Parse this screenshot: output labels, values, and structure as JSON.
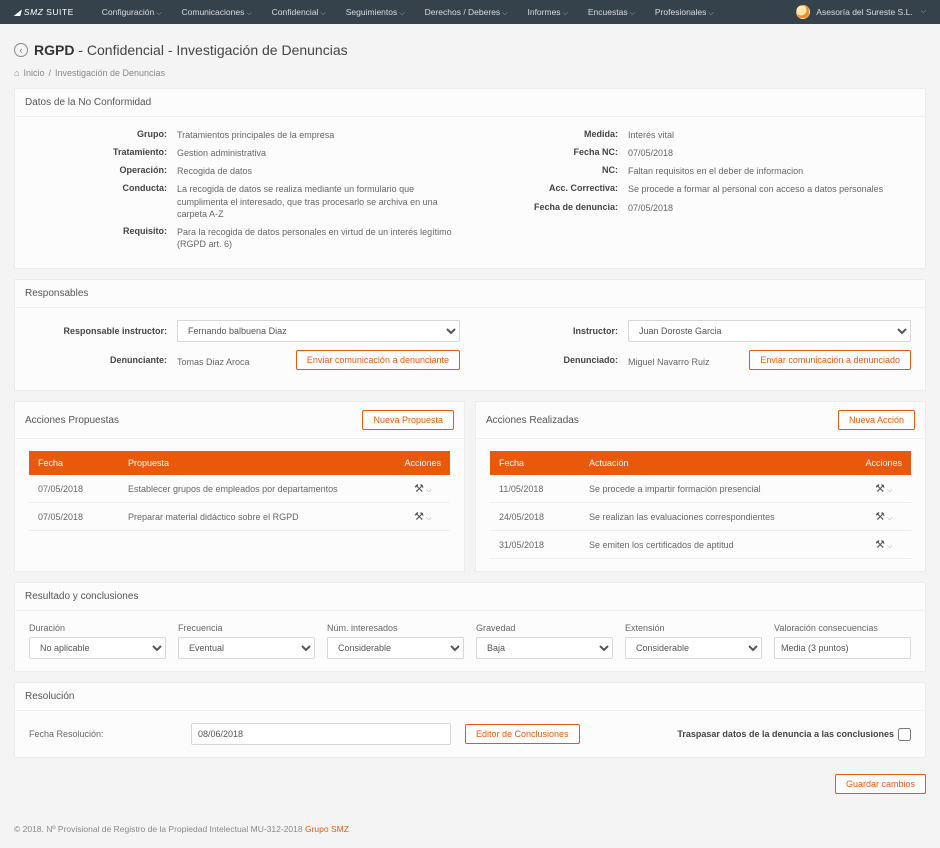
{
  "nav": {
    "brand": "SMZ SUITE",
    "items": [
      "Configuración",
      "Comunicaciones",
      "Confidencial",
      "Seguimientos",
      "Derechos / Deberes",
      "Informes",
      "Encuestas",
      "Profesionales"
    ],
    "user": "Asesoría del Sureste S.L."
  },
  "title": {
    "strong": "RGPD",
    "rest": " - Confidencial - Investigación de Denuncias"
  },
  "breadcrumb": {
    "home": "Inicio",
    "current": "Investigación de Denuncias"
  },
  "nc": {
    "header": "Datos de la No Conformidad",
    "left": [
      {
        "l": "Grupo:",
        "v": "Tratamientos principales de la empresa"
      },
      {
        "l": "Tratamiento:",
        "v": "Gestion administrativa"
      },
      {
        "l": "Operación:",
        "v": "Recogida de datos"
      },
      {
        "l": "Conducta:",
        "v": "La recogida de datos se realiza mediante un formulario que cumplimenta el interesado, que tras procesarlo se archiva en una carpeta A-Z"
      },
      {
        "l": "Requisito:",
        "v": "Para la recogida de datos personales en virtud de un interés legítimo (RGPD art. 6)"
      }
    ],
    "right": [
      {
        "l": "Medida:",
        "v": "Interés vital"
      },
      {
        "l": "Fecha NC:",
        "v": "07/05/2018"
      },
      {
        "l": "NC:",
        "v": "Faltan requisitos en el deber de informacion"
      },
      {
        "l": "Acc. Correctiva:",
        "v": "Se procede a formar al personal con acceso a datos personales"
      },
      {
        "l": "Fecha de denuncia:",
        "v": "07/05/2018"
      }
    ]
  },
  "resp": {
    "header": "Responsables",
    "instructor_label": "Responsable instructor:",
    "instructor_value": "Fernando balbuena Diaz",
    "instructor2_label": "Instructor:",
    "instructor2_value": "Juan Doroste Garcia",
    "den_label": "Denunciante:",
    "den_value": "Tomas Diaz Aroca",
    "denado_label": "Denunciado:",
    "denado_value": "Miguel Navarro Ruiz",
    "btn_denunciante": "Enviar comunicación a denunciante",
    "btn_denunciado": "Enviar comunicación a denunciado"
  },
  "propuestas": {
    "header": "Acciones Propuestas",
    "new_btn": "Nueva Propuesta",
    "cols": [
      "Fecha",
      "Propuesta",
      "Acciones"
    ],
    "rows": [
      {
        "f": "07/05/2018",
        "p": "Establecer grupos de empleados por departamentos"
      },
      {
        "f": "07/05/2018",
        "p": "Preparar material didáctico sobre el RGPD"
      }
    ]
  },
  "realizadas": {
    "header": "Acciones Realizadas",
    "new_btn": "Nueva Acción",
    "cols": [
      "Fecha",
      "Actuación",
      "Acciones"
    ],
    "rows": [
      {
        "f": "11/05/2018",
        "p": "Se procede a impartir formación presencial"
      },
      {
        "f": "24/05/2018",
        "p": "Se realizan las evaluaciones correspondientes"
      },
      {
        "f": "31/05/2018",
        "p": "Se emiten los certificados de aptitud"
      }
    ]
  },
  "result": {
    "header": "Resultado y conclusiones",
    "fields": {
      "duracion": {
        "l": "Duración",
        "v": "No aplicable"
      },
      "frecuencia": {
        "l": "Frecuencia",
        "v": "Eventual"
      },
      "interesados": {
        "l": "Núm. interesados",
        "v": "Considerable"
      },
      "gravedad": {
        "l": "Gravedad",
        "v": "Baja"
      },
      "extension": {
        "l": "Extensión",
        "v": "Considerable"
      },
      "valoracion": {
        "l": "Valoración consecuencias",
        "v": "Media (3 puntos)"
      }
    }
  },
  "resol": {
    "header": "Resolución",
    "fecha_label": "Fecha Resolución:",
    "fecha_value": "08/06/2018",
    "editor_btn": "Editor de Conclusiones",
    "traspasar": "Traspasar datos de la denuncia a las conclusiones"
  },
  "save_btn": "Guardar cambios",
  "copyright": {
    "text": "© 2018. Nº Provisional de Registro de la Propiedad Intelectual MU-312-2018 ",
    "link": "Grupo SMZ"
  }
}
